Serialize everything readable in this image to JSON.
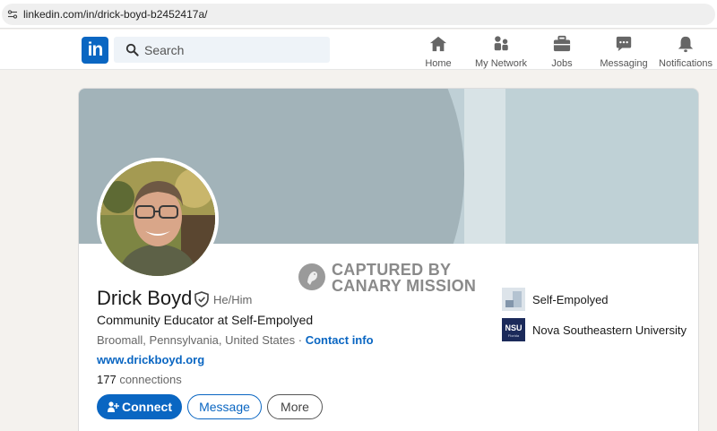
{
  "browser": {
    "url": "linkedin.com/in/drick-boyd-b2452417a/"
  },
  "nav": {
    "logo": "in",
    "search_placeholder": "Search",
    "items": [
      {
        "label": "Home",
        "icon": "home-icon"
      },
      {
        "label": "My Network",
        "icon": "network-icon"
      },
      {
        "label": "Jobs",
        "icon": "briefcase-icon"
      },
      {
        "label": "Messaging",
        "icon": "messaging-icon"
      },
      {
        "label": "Notifications",
        "icon": "bell-icon"
      }
    ]
  },
  "watermark": {
    "line1": "CAPTURED BY",
    "line2": "CANARY MISSION"
  },
  "profile": {
    "name": "Drick Boyd",
    "pronouns": "He/Him",
    "headline": "Community Educator at Self-Empolyed",
    "location": "Broomall, Pennsylvania, United States",
    "location_sep": " · ",
    "contact_info": "Contact info",
    "website": "www.drickboyd.org",
    "connections_count": "177",
    "connections_label": " connections"
  },
  "actions": {
    "connect": "Connect",
    "message": "Message",
    "more": "More"
  },
  "experience": [
    {
      "label": "Self-Empolyed"
    },
    {
      "label": "Nova Southeastern University",
      "logo_text": "NSU",
      "logo_sub": "Florida"
    }
  ],
  "colors": {
    "brand": "#0a66c2",
    "banner": "#bfd0d6",
    "background": "#f4f2ee"
  }
}
